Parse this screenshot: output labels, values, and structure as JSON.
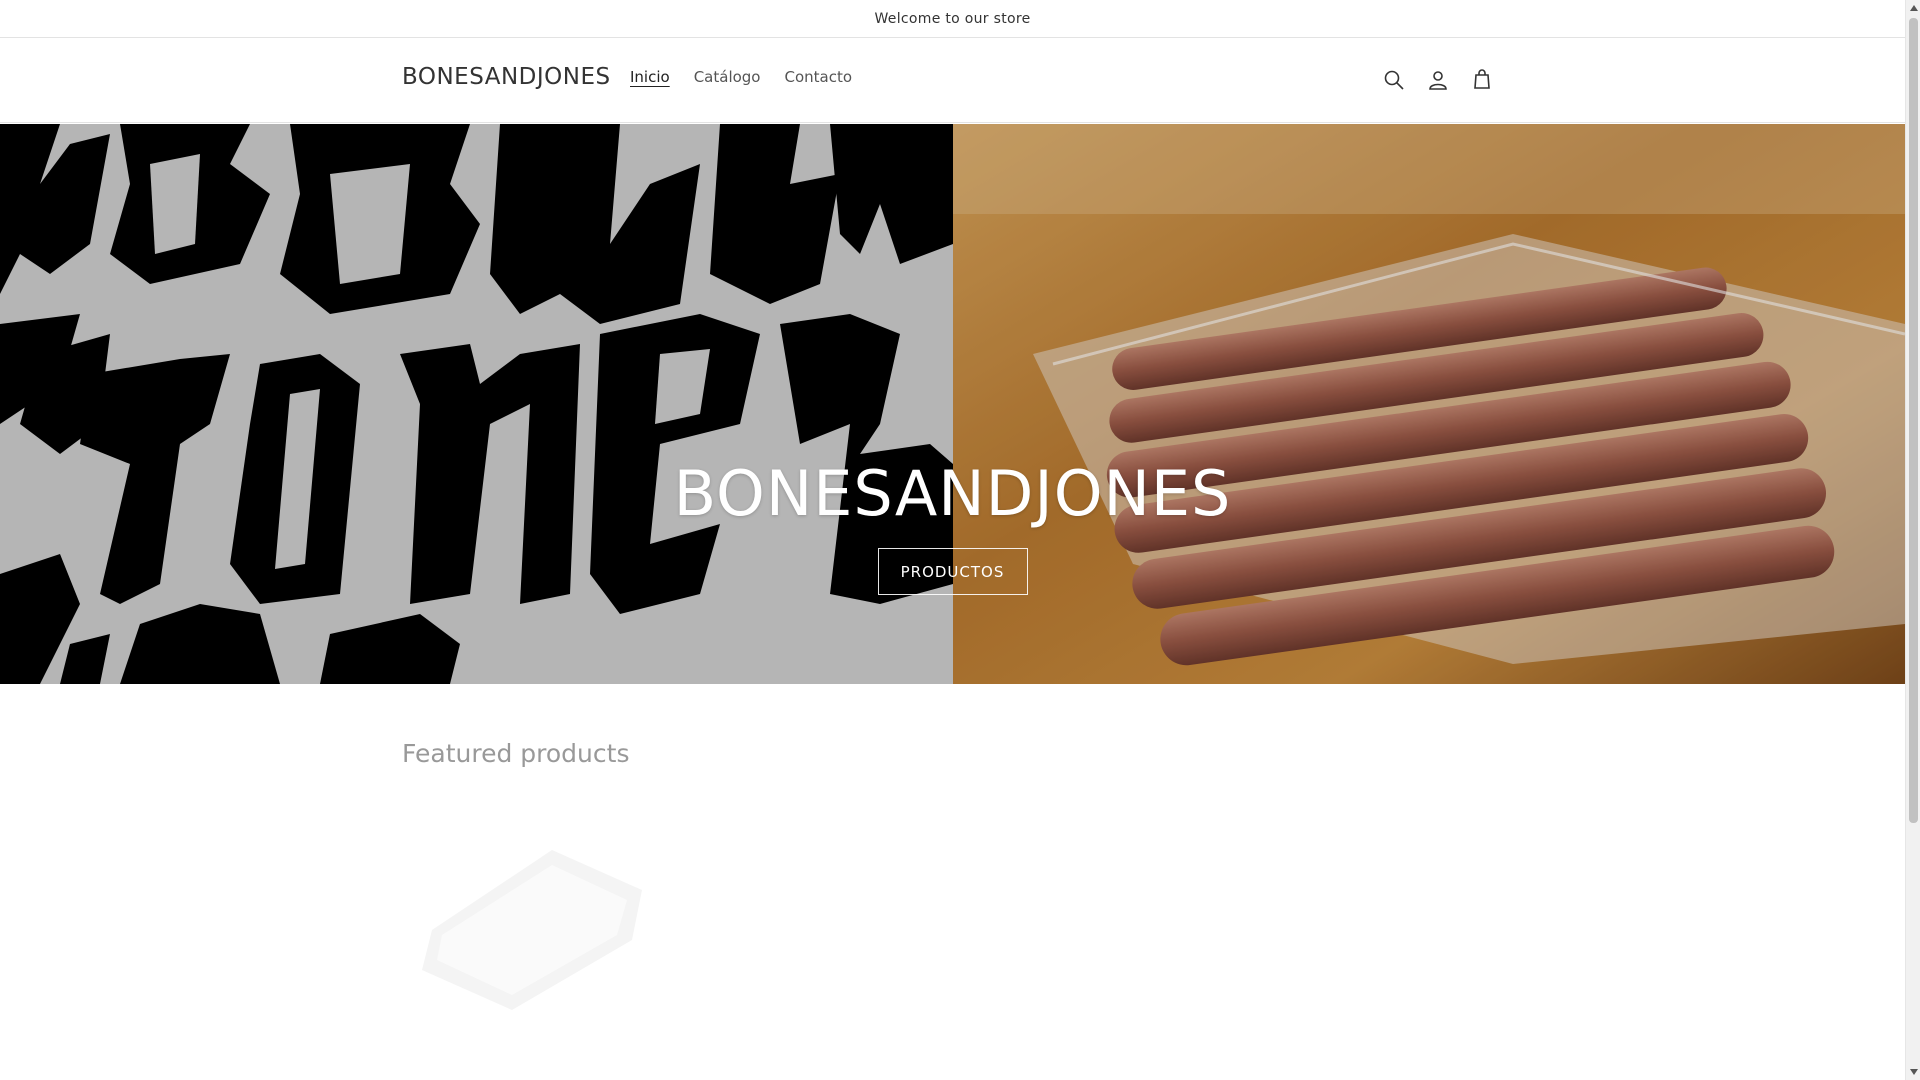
{
  "announcement": {
    "text": "Welcome to our store"
  },
  "header": {
    "logo": "BONESANDJONES",
    "nav": [
      {
        "label": "Inicio"
      },
      {
        "label": "Catálogo"
      },
      {
        "label": "Contacto"
      }
    ],
    "icons": [
      "search-icon",
      "account-icon",
      "cart-icon"
    ]
  },
  "hero": {
    "title": "BONESANDJONES",
    "button_label": "PRODUCTOS",
    "left_image": "blackletter-logo-image",
    "right_image": "sausages-image"
  },
  "featured": {
    "title": "Featured products"
  },
  "colors": {
    "text": "#121212",
    "muted": "#999999",
    "hero_left_bg": "#cfcfcf"
  }
}
